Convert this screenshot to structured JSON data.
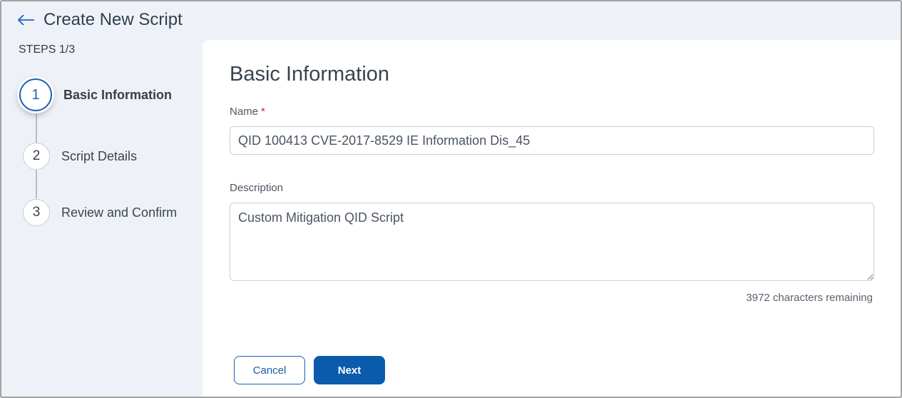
{
  "header": {
    "back_icon": "arrow-left-icon",
    "title": "Create New Script"
  },
  "sidebar": {
    "steps_label": "STEPS 1/3",
    "steps": [
      {
        "number": "1",
        "label": "Basic Information",
        "active": true
      },
      {
        "number": "2",
        "label": "Script Details",
        "active": false
      },
      {
        "number": "3",
        "label": "Review and Confirm",
        "active": false
      }
    ]
  },
  "main": {
    "section_title": "Basic Information",
    "name_field": {
      "label": "Name",
      "required_marker": "*",
      "value": "QID 100413 CVE-2017-8529 IE Information Dis_45"
    },
    "description_field": {
      "label": "Description",
      "value": "Custom Mitigation QID Script",
      "chars_remaining": "3972 characters remaining"
    },
    "buttons": {
      "cancel_label": "Cancel",
      "next_label": "Next"
    }
  },
  "colors": {
    "accent": "#0b5bad",
    "required": "#d21e2b",
    "sidebar_bg": "#eef2f8"
  }
}
